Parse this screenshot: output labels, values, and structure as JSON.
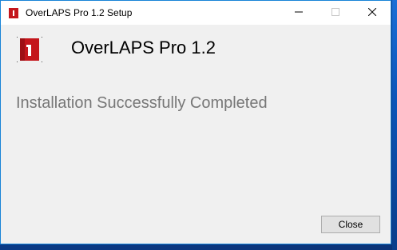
{
  "window": {
    "title": "OverLAPS Pro 1.2 Setup",
    "caption_buttons": {
      "minimize_icon": "minimize-icon",
      "maximize_icon": "maximize-icon",
      "close_icon": "close-icon"
    }
  },
  "header": {
    "app_name": "OverLAPS Pro 1.2",
    "icon": "app-logo-icon"
  },
  "main": {
    "status": "Installation Successfully Completed"
  },
  "footer": {
    "close_label": "Close"
  },
  "colors": {
    "window_border": "#1883d7",
    "logo_red": "#c4161c",
    "status_text": "#777777",
    "desktop": "#0b4fa8"
  }
}
